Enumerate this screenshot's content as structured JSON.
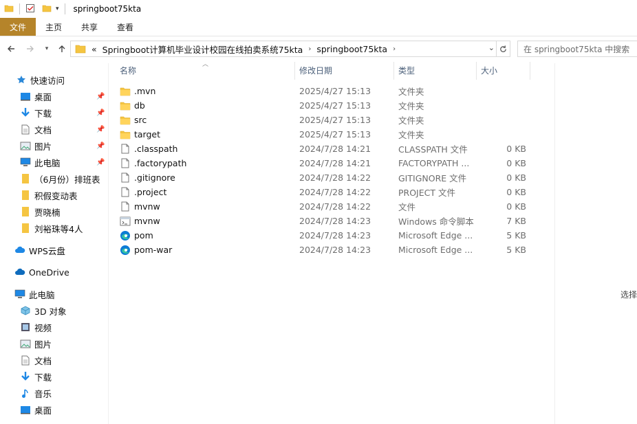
{
  "window": {
    "title": "springboot75kta"
  },
  "ribbon": {
    "tabs": [
      "文件",
      "主页",
      "共享",
      "查看"
    ]
  },
  "address": {
    "prefix": "«",
    "crumbs": [
      "Springboot计算机毕业设计校园在线拍卖系统75kta",
      "springboot75kta"
    ]
  },
  "search": {
    "placeholder": "在 springboot75kta 中搜索"
  },
  "nav": {
    "quick_access": "快速访问",
    "quick_items": [
      "桌面",
      "下载",
      "文档",
      "图片",
      "此电脑",
      "（6月份）排班表",
      "积假变动表",
      "贾晓楠",
      "刘裕珠等4人"
    ],
    "wps": "WPS云盘",
    "onedrive": "OneDrive",
    "this_pc": "此电脑",
    "pc_items": [
      "3D 对象",
      "视频",
      "图片",
      "文档",
      "下载",
      "音乐",
      "桌面"
    ]
  },
  "columns": {
    "name": "名称",
    "date": "修改日期",
    "type": "类型",
    "size": "大小"
  },
  "files": [
    {
      "name": ".mvn",
      "date": "2025/4/27 15:13",
      "type": "文件夹",
      "size": "",
      "icon": "folder-icon"
    },
    {
      "name": "db",
      "date": "2025/4/27 15:13",
      "type": "文件夹",
      "size": "",
      "icon": "folder-icon"
    },
    {
      "name": "src",
      "date": "2025/4/27 15:13",
      "type": "文件夹",
      "size": "",
      "icon": "folder-icon"
    },
    {
      "name": "target",
      "date": "2025/4/27 15:13",
      "type": "文件夹",
      "size": "",
      "icon": "folder-icon"
    },
    {
      "name": ".classpath",
      "date": "2024/7/28 14:21",
      "type": "CLASSPATH 文件",
      "size": "0 KB",
      "icon": "file-icon"
    },
    {
      "name": ".factorypath",
      "date": "2024/7/28 14:21",
      "type": "FACTORYPATH ...",
      "size": "0 KB",
      "icon": "file-icon"
    },
    {
      "name": ".gitignore",
      "date": "2024/7/28 14:22",
      "type": "GITIGNORE 文件",
      "size": "0 KB",
      "icon": "file-icon"
    },
    {
      "name": ".project",
      "date": "2024/7/28 14:22",
      "type": "PROJECT 文件",
      "size": "0 KB",
      "icon": "file-icon"
    },
    {
      "name": "mvnw",
      "date": "2024/7/28 14:22",
      "type": "文件",
      "size": "0 KB",
      "icon": "file-icon"
    },
    {
      "name": "mvnw",
      "date": "2024/7/28 14:23",
      "type": "Windows 命令脚本",
      "size": "7 KB",
      "icon": "script-icon"
    },
    {
      "name": "pom",
      "date": "2024/7/28 14:23",
      "type": "Microsoft Edge ...",
      "size": "5 KB",
      "icon": "edge-icon"
    },
    {
      "name": "pom-war",
      "date": "2024/7/28 14:23",
      "type": "Microsoft Edge ...",
      "size": "5 KB",
      "icon": "edge-icon"
    }
  ],
  "details_pane": {
    "label": "选择"
  },
  "colors": {
    "file_tab": "#b5842a",
    "folder": "#f5c542",
    "column_header": "#4c607a",
    "accent": "#0078d7"
  }
}
